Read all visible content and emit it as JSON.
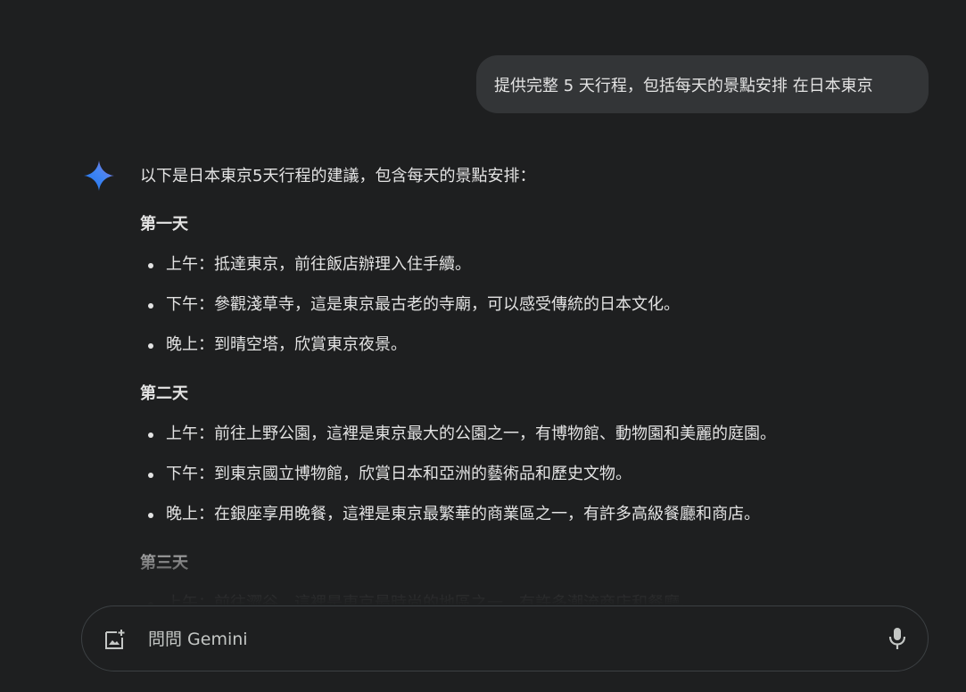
{
  "conversation": {
    "user_message": "提供完整 5 天行程，包括每天的景點安排 在日本東京",
    "response": {
      "intro": "以下是日本東京5天行程的建議，包含每天的景點安排：",
      "days": [
        {
          "heading": "第一天",
          "items": [
            "上午：抵達東京，前往飯店辦理入住手續。",
            "下午：參觀淺草寺，這是東京最古老的寺廟，可以感受傳統的日本文化。",
            "晚上：到晴空塔，欣賞東京夜景。"
          ]
        },
        {
          "heading": "第二天",
          "items": [
            "上午：前往上野公園，這裡是東京最大的公園之一，有博物館、動物園和美麗的庭園。",
            "下午：到東京國立博物館，欣賞日本和亞洲的藝術品和歷史文物。",
            "晚上：在銀座享用晚餐，這裡是東京最繁華的商業區之一，有許多高級餐廳和商店。"
          ]
        },
        {
          "heading": "第三天",
          "items": [
            "上午：前往澀谷，這裡是東京最時尚的地區之一，有許多潮流商店和餐廳。"
          ]
        }
      ]
    }
  },
  "input_bar": {
    "placeholder": "問問 Gemini",
    "upload_icon": "add-image-icon",
    "mic_icon": "microphone-icon"
  },
  "colors": {
    "background": "#1e1f20",
    "user_bubble": "#333537",
    "text": "#e3e3e3",
    "accent_blue": "#4285f4"
  }
}
